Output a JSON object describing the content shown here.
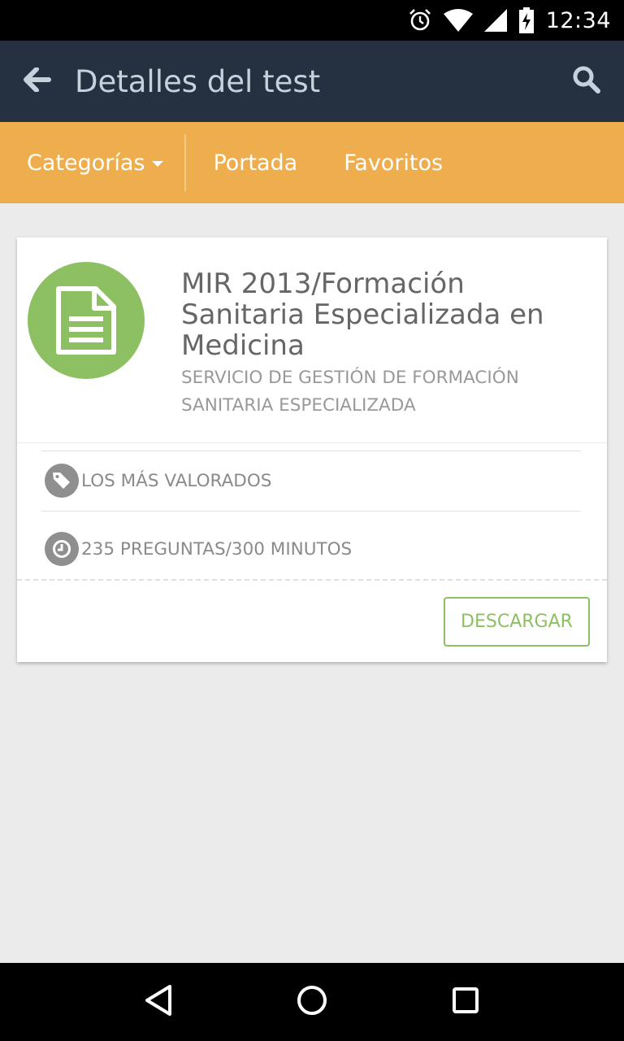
{
  "status_bar": {
    "time": "12:34",
    "icons": [
      "alarm-icon",
      "wifi-icon",
      "signal-icon",
      "battery-charging-icon"
    ]
  },
  "app_bar": {
    "title": "Detalles del test",
    "back_icon": "arrow-left-icon",
    "search_icon": "search-icon",
    "background": "#253040"
  },
  "tabs": {
    "background": "#eeae4e",
    "items": [
      {
        "label": "Categorías",
        "has_dropdown": true
      },
      {
        "label": "Portada"
      },
      {
        "label": "Favoritos"
      }
    ]
  },
  "test_card": {
    "icon": "document-icon",
    "accent": "#8dc063",
    "title": "MIR 2013/Formación Sanitaria Especializada en Medicina",
    "subtitle": "SERVICIO DE GESTIÓN DE FORMACIÓN SANITARIA ESPECIALIZADA",
    "tag_icon": "tags-icon",
    "tag_label": "LOS MÁS VALORADOS",
    "info_icon": "clock-icon",
    "info_label": "235 PREGUNTAS/300 MINUTOS",
    "download_label": "DESCARGAR"
  },
  "nav_bar": {
    "icons": [
      "back-triangle-icon",
      "home-circle-icon",
      "recents-square-icon"
    ]
  }
}
